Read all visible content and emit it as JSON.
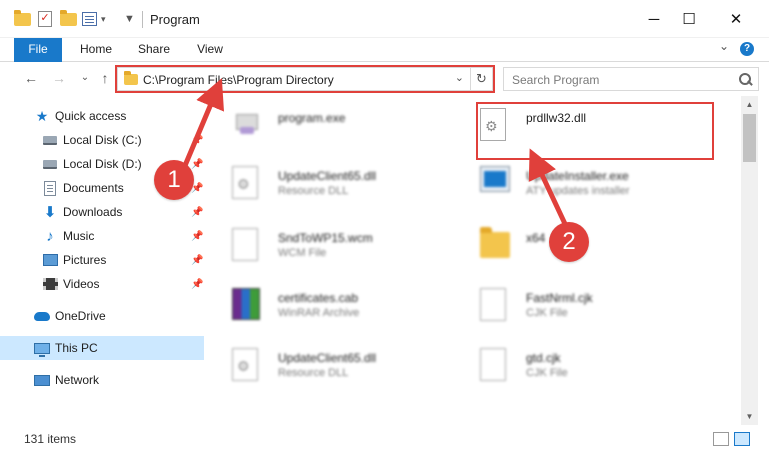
{
  "window": {
    "title": "Program",
    "minimize": "─",
    "maximize": "☐",
    "close": "✕"
  },
  "ribbon": {
    "tabs": [
      "File",
      "Home",
      "Share",
      "View"
    ],
    "expand": "⌄",
    "help": "?"
  },
  "nav": {
    "back": "←",
    "forward": "→",
    "recent": "⌄",
    "up": "↑"
  },
  "address": {
    "path": "C:\\Program Files\\Program Directory",
    "dropdown": "⌄",
    "refresh": "↻"
  },
  "search": {
    "placeholder": "Search Program"
  },
  "sidebar": {
    "items": [
      {
        "label": "Quick access",
        "icon": "star-icon",
        "pinned": false
      },
      {
        "label": "Local Disk (C:)",
        "icon": "disk-icon",
        "pinned": true
      },
      {
        "label": "Local Disk (D:)",
        "icon": "disk-icon",
        "pinned": true
      },
      {
        "label": "Documents",
        "icon": "documents-icon",
        "pinned": true
      },
      {
        "label": "Downloads",
        "icon": "downloads-icon",
        "pinned": true
      },
      {
        "label": "Music",
        "icon": "music-icon",
        "pinned": true
      },
      {
        "label": "Pictures",
        "icon": "pictures-icon",
        "pinned": true
      },
      {
        "label": "Videos",
        "icon": "videos-icon",
        "pinned": true
      },
      {
        "label": "OneDrive",
        "icon": "onedrive-icon",
        "pinned": false
      },
      {
        "label": "This PC",
        "icon": "this-pc-icon",
        "pinned": false,
        "selected": true
      },
      {
        "label": "Network",
        "icon": "network-icon",
        "pinned": false
      }
    ],
    "pin_glyph": "📌"
  },
  "files": {
    "left": [
      {
        "name": "program.exe",
        "type": "",
        "icon": "exe-icon"
      },
      {
        "name": "UpdateClient65.dll",
        "type": "Resource DLL",
        "icon": "dll-icon"
      },
      {
        "name": "SndToWP15.wcm",
        "type": "WCM File",
        "icon": "file-icon"
      },
      {
        "name": "certificates.cab",
        "type": "WinRAR Archive",
        "icon": "winrar-icon"
      },
      {
        "name": "UpdateClient65.dll",
        "type": "Resource DLL",
        "icon": "dll-icon"
      }
    ],
    "right": [
      {
        "name": "prdllw32.dll",
        "type": "",
        "icon": "dll-icon"
      },
      {
        "name": "UpdateInstaller.exe",
        "type": "ATY updates installer",
        "icon": "installer-icon"
      },
      {
        "name": "x64",
        "type": "",
        "icon": "folder-icon"
      },
      {
        "name": "FastNrml.cjk",
        "type": "CJK File",
        "icon": "file-icon"
      },
      {
        "name": "gtd.cjk",
        "type": "CJK File",
        "icon": "file-icon"
      }
    ]
  },
  "status": {
    "count": "131 items"
  },
  "callouts": {
    "one": "1",
    "two": "2",
    "color": "#e0403b"
  },
  "colors": {
    "accent": "#1979ca",
    "selection": "#cce8ff"
  }
}
